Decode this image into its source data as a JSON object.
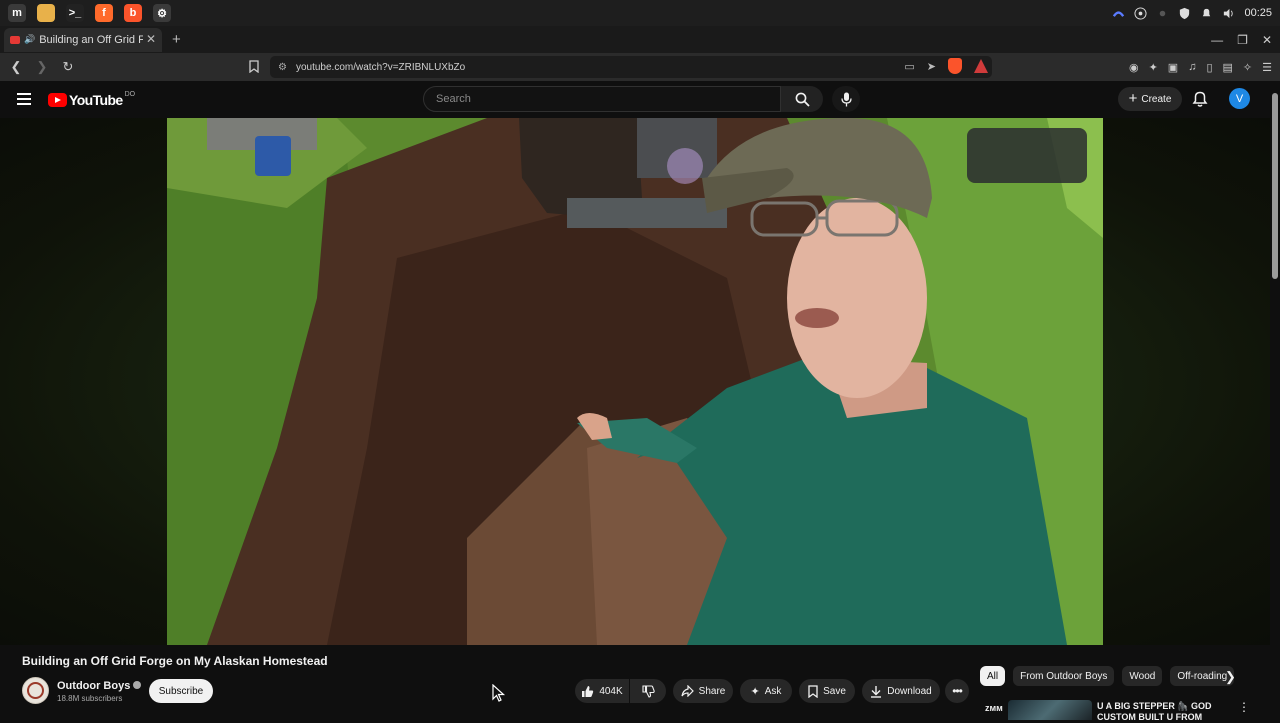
{
  "taskbar": {
    "apps": [
      {
        "name": "linux-mint-menu",
        "color": "#3a3a3a",
        "glyph": "m"
      },
      {
        "name": "files",
        "color": "#e8b14a",
        "glyph": ""
      },
      {
        "name": "terminal",
        "color": "#222222",
        "glyph": ">_"
      },
      {
        "name": "firefox",
        "color": "#ff6a2b",
        "glyph": "f"
      },
      {
        "name": "brave",
        "color": "#fb542b",
        "glyph": "b"
      },
      {
        "name": "settings",
        "color": "#3a3a3a",
        "glyph": "⚙"
      }
    ],
    "clock": "00:25"
  },
  "browser": {
    "tab_title": "Building an Off Grid Forge",
    "url": "youtube.com/watch?v=ZRIBNLUXbZo"
  },
  "youtube": {
    "logo_text": "YouTube",
    "logo_superscript": "DO",
    "search_placeholder": "Search",
    "create_label": "Create",
    "avatar_letter": "V"
  },
  "video": {
    "title": "Building an Off Grid Forge on My Alaskan Homestead",
    "channel_name": "Outdoor Boys",
    "subscribers": "18.8M subscribers",
    "subscribe_label": "Subscribe",
    "likes": "404K",
    "share_label": "Share",
    "ask_label": "Ask",
    "save_label": "Save",
    "download_label": "Download"
  },
  "sidebar": {
    "chips": [
      {
        "label": "All",
        "active": true
      },
      {
        "label": "From Outdoor Boys",
        "active": false
      },
      {
        "label": "Wood",
        "active": false
      },
      {
        "label": "Off-roading",
        "active": false
      }
    ],
    "recommendation": {
      "badge": "ᴢᴍᴍ",
      "title": "U A BIG STEPPER 🦍 GOD CUSTOM BUILT U FROM"
    }
  }
}
